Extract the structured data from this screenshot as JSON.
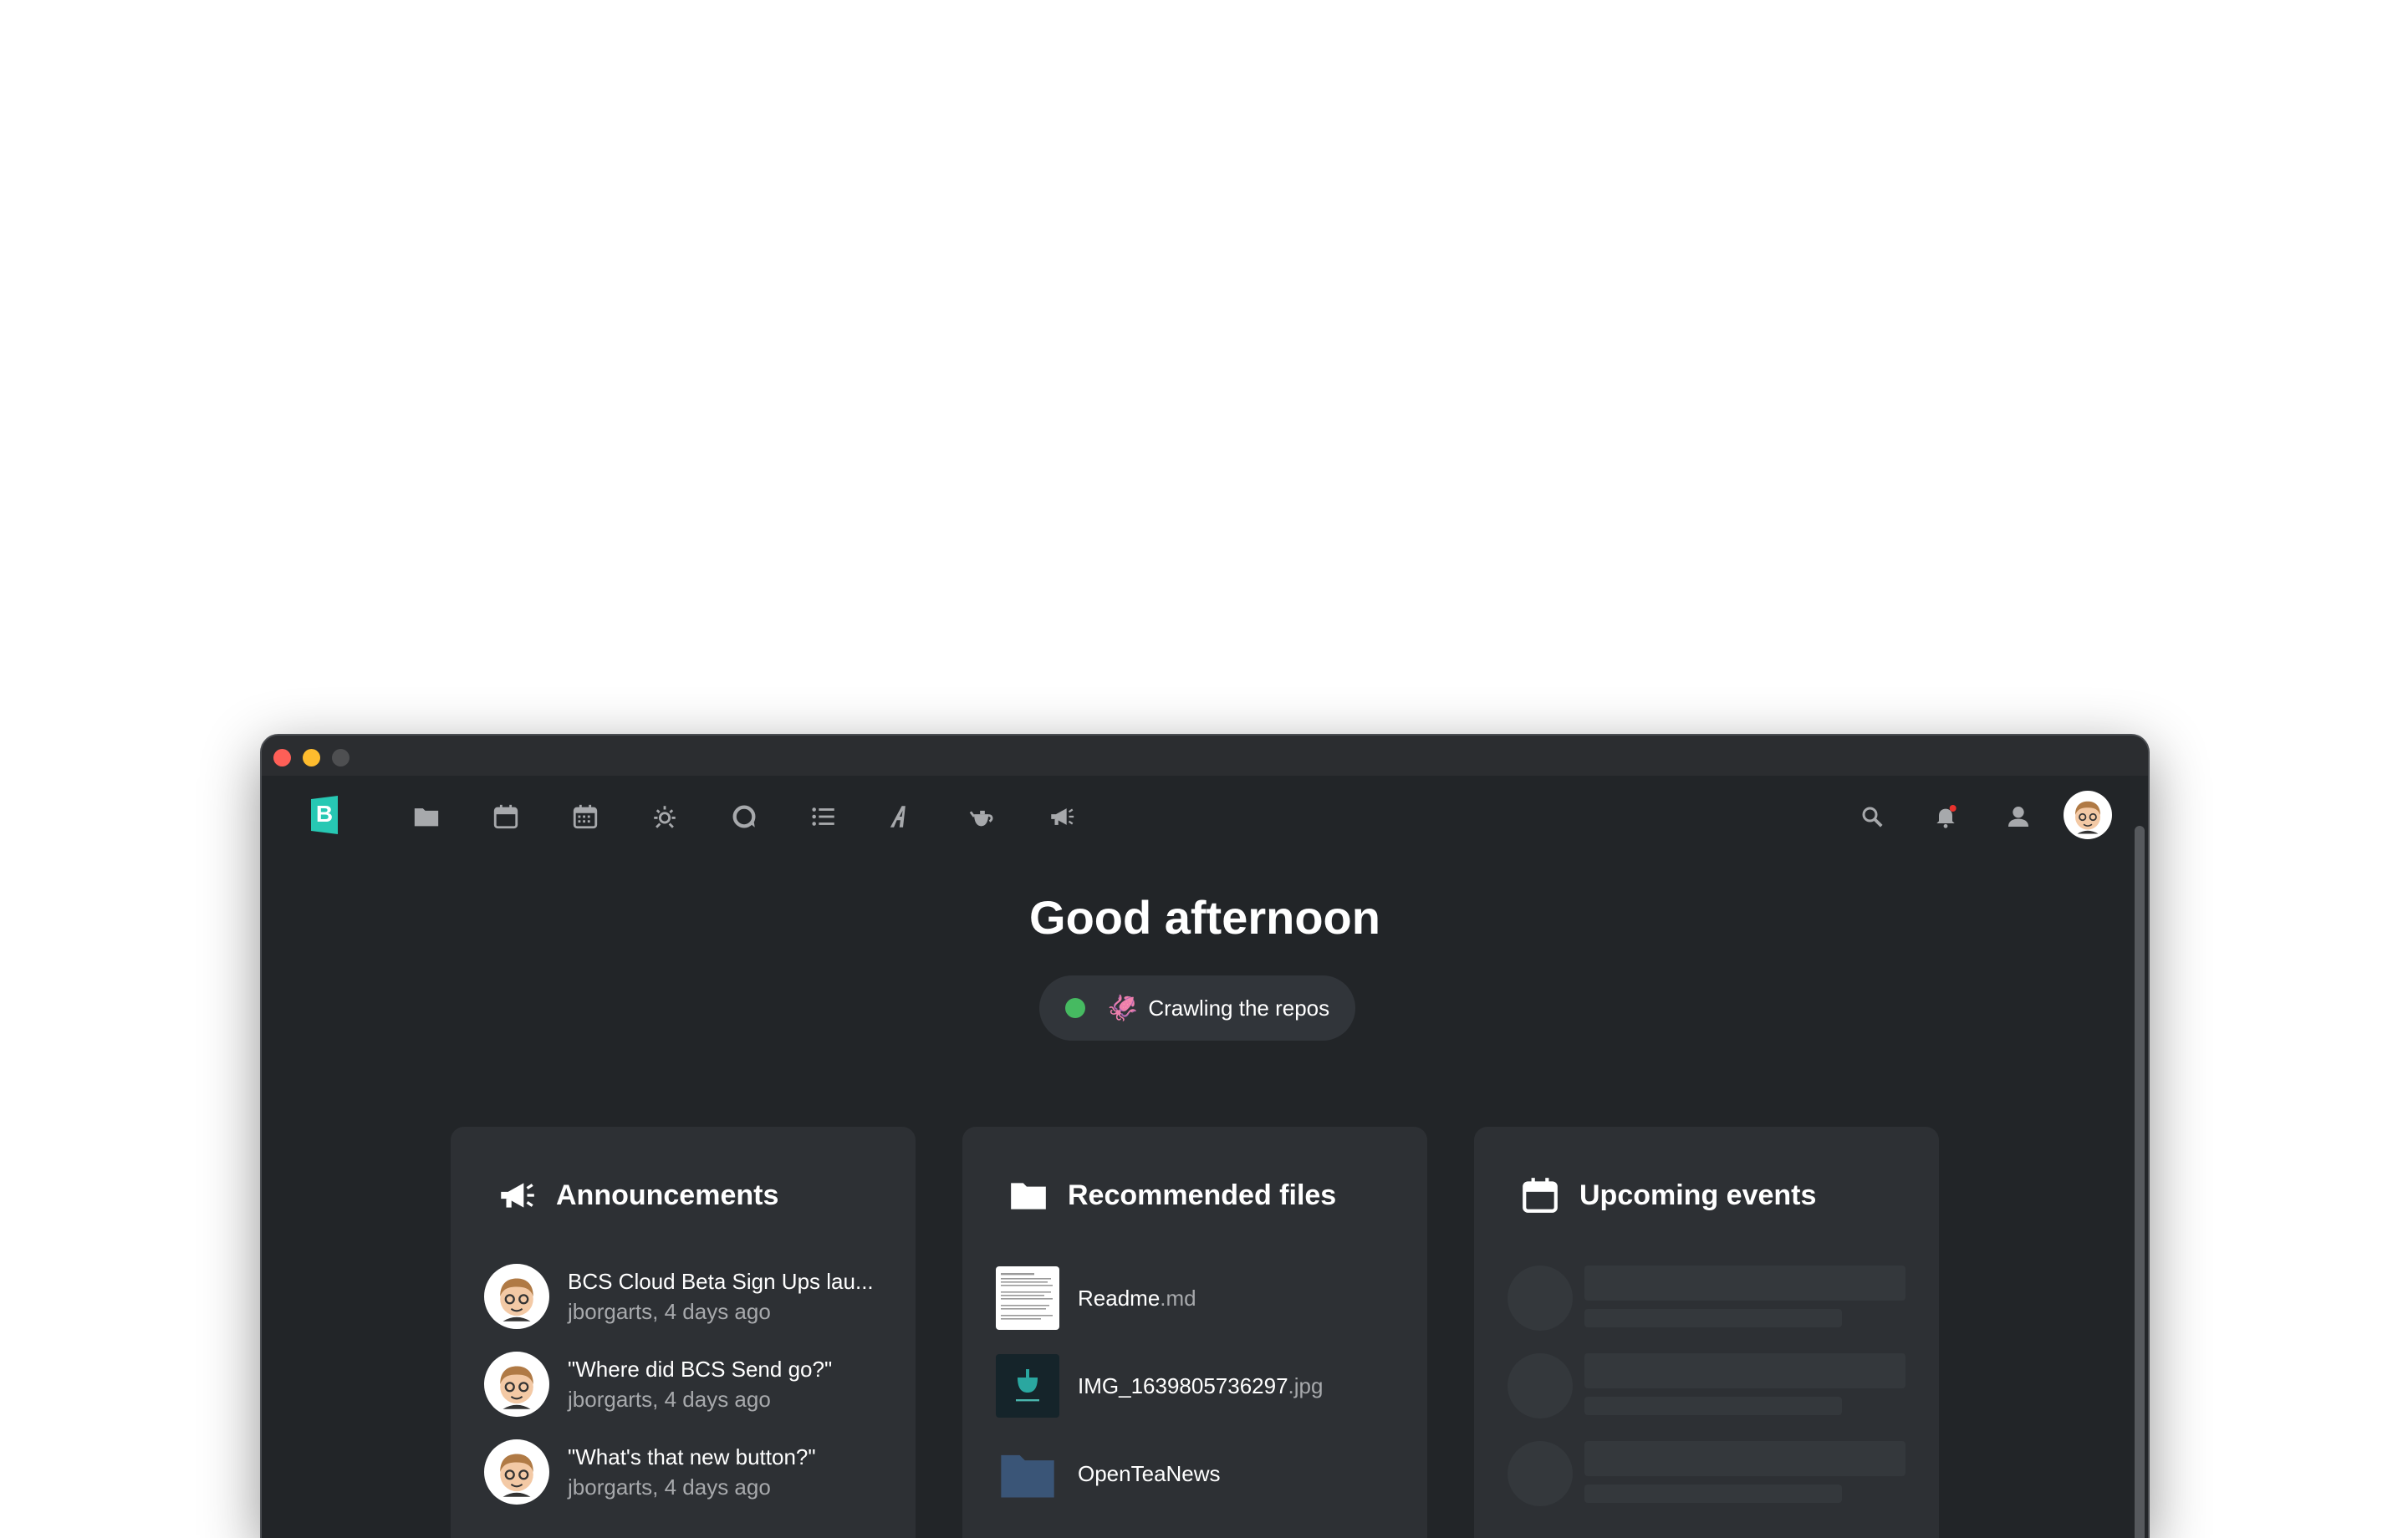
{
  "nav": {
    "logo_letter": "B",
    "icons": [
      "folder-icon",
      "calendar-icon",
      "calendar-grid-icon",
      "sun-icon",
      "chat-icon",
      "list-icon",
      "text-icon",
      "teapot-icon",
      "megaphone-icon"
    ],
    "right_icons": [
      "search-icon",
      "bell-icon",
      "contacts-icon",
      "avatar"
    ],
    "notification_color": "#e9322d"
  },
  "greeting": "Good afternoon",
  "status": {
    "emoji": "🦑",
    "text": "Crawling the repos",
    "dot_color": "#46ba61"
  },
  "announcements": {
    "title": "Announcements",
    "items": [
      {
        "title": "BCS Cloud Beta Sign Ups lau...",
        "meta": "jborgarts, 4 days ago"
      },
      {
        "title": "\"Where did BCS Send go?\"",
        "meta": "jborgarts, 4 days ago"
      },
      {
        "title": "\"What's that new button?\"",
        "meta": "jborgarts, 4 days ago"
      }
    ]
  },
  "recommended_files": {
    "title": "Recommended files",
    "items": [
      {
        "name": "Readme",
        "ext": ".md"
      },
      {
        "name": "IMG_1639805736297",
        "ext": ".jpg"
      },
      {
        "name": "OpenTeaNews",
        "ext": ""
      }
    ]
  },
  "upcoming_events": {
    "title": "Upcoming events"
  },
  "colors": {
    "accent": "#27c8b3",
    "background": "#222528",
    "panel": "#2d3034"
  }
}
